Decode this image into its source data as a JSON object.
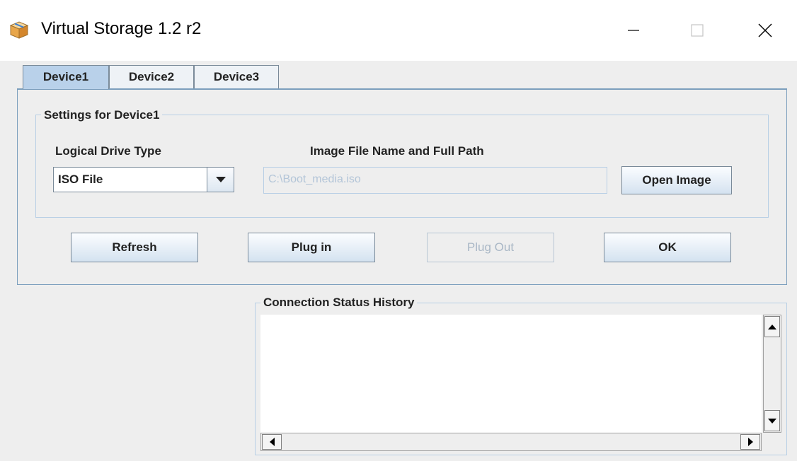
{
  "window": {
    "title": "Virtual Storage 1.2 r2",
    "icons": {
      "app": "package-icon",
      "minimize": "minimize-icon",
      "maximize": "maximize-icon",
      "close": "close-icon"
    }
  },
  "tabs": [
    {
      "label": "Device1",
      "active": true
    },
    {
      "label": "Device2",
      "active": false
    },
    {
      "label": "Device3",
      "active": false
    }
  ],
  "settings": {
    "group_title": "Settings for Device1",
    "drive_type_label": "Logical Drive Type",
    "drive_type_value": "ISO File",
    "image_path_label": "Image File Name and Full Path",
    "image_path_value": "C:\\Boot_media.iso",
    "open_image_label": "Open Image"
  },
  "actions": {
    "refresh_label": "Refresh",
    "plug_in_label": "Plug in",
    "plug_out_label": "Plug Out",
    "ok_label": "OK"
  },
  "status": {
    "title": "Connection Status History",
    "entries": []
  },
  "colors": {
    "active_tab": "#b9d1ea",
    "border_blue": "#7b9ebd",
    "background": "#eeeeee",
    "disabled_text": "#a9b7c6"
  }
}
